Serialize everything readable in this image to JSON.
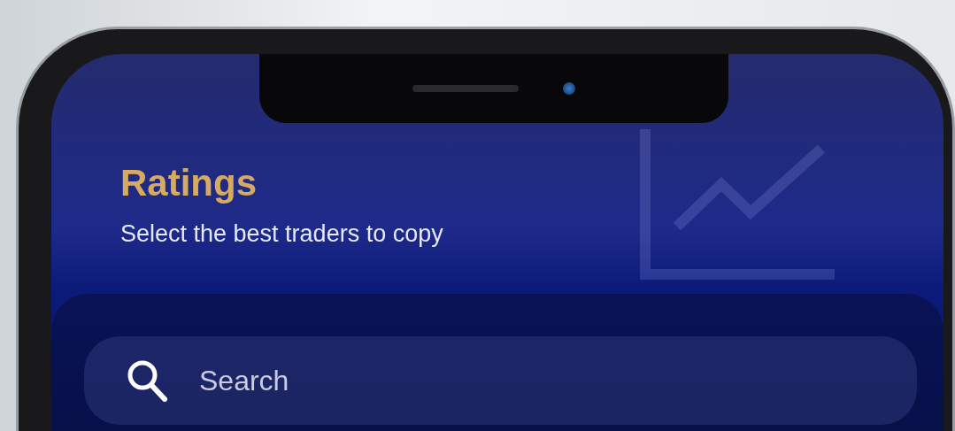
{
  "screen": {
    "title": "Ratings",
    "subtitle": "Select the best traders to copy",
    "search": {
      "placeholder": "Search"
    }
  }
}
